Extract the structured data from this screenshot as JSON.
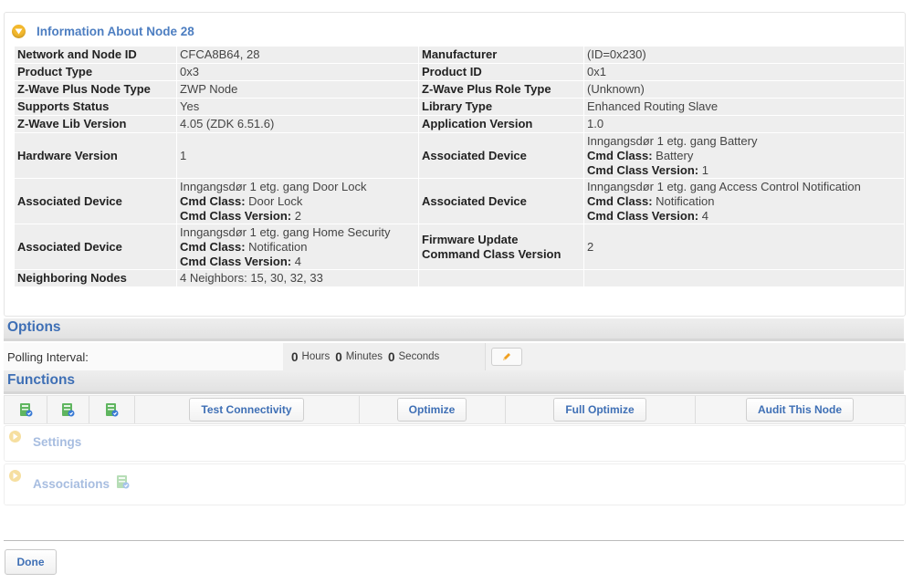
{
  "info_panel": {
    "title": "Information About Node 28",
    "rows": [
      {
        "k1": "Network and Node ID",
        "v1": "CFCA8B64, 28",
        "k2": "Manufacturer",
        "v2": "(ID=0x230)"
      },
      {
        "k1": "Product Type",
        "v1": "0x3",
        "k2": "Product ID",
        "v2": "0x1"
      },
      {
        "k1": "Z-Wave Plus Node Type",
        "v1": "ZWP Node",
        "k2": "Z-Wave Plus Role Type",
        "v2": "(Unknown)"
      },
      {
        "k1": "Supports Status",
        "v1": "Yes",
        "k2": "Library Type",
        "v2": "Enhanced Routing Slave"
      },
      {
        "k1": "Z-Wave Lib Version",
        "v1": "4.05 (ZDK 6.51.6)",
        "k2": "Application Version",
        "v2": "1.0"
      }
    ],
    "hardware_label": "Hardware Version",
    "hardware_value": "1",
    "associated_label": "Associated Device",
    "cmd_class_label": "Cmd Class:",
    "cmd_class_version_label": "Cmd Class Version:",
    "assoc_battery": {
      "device": "Inngangsdør 1 etg. gang Battery",
      "cmd_class": "Battery",
      "version": "1"
    },
    "assoc_door_lock": {
      "device": "Inngangsdør 1 etg. gang Door Lock",
      "cmd_class": "Door Lock",
      "version": "2"
    },
    "assoc_access_control": {
      "device": "Inngangsdør 1 etg. gang Access Control Notification",
      "cmd_class": "Notification",
      "version": "4"
    },
    "assoc_home_security": {
      "device": "Inngangsdør 1 etg. gang Home Security",
      "cmd_class": "Notification",
      "version": "4"
    },
    "firmware_label_1": "Firmware Update",
    "firmware_label_2": "Command Class Version",
    "firmware_value": "2",
    "neighbors_label": "Neighboring Nodes",
    "neighbors_value": "4 Neighbors: 15, 30, 32, 33"
  },
  "options": {
    "title": "Options",
    "polling_label": "Polling Interval:",
    "hours": "0",
    "hours_unit": "Hours",
    "minutes": "0",
    "minutes_unit": "Minutes",
    "seconds": "0",
    "seconds_unit": "Seconds"
  },
  "functions": {
    "title": "Functions",
    "buttons": [
      "Test Connectivity",
      "Optimize",
      "Full Optimize",
      "Audit This Node"
    ]
  },
  "sections": {
    "settings": "Settings",
    "associations": "Associations"
  },
  "footer": {
    "done": "Done"
  },
  "colors": {
    "accent": "#3e6fb5",
    "expand_icon": "#f3b82d"
  }
}
